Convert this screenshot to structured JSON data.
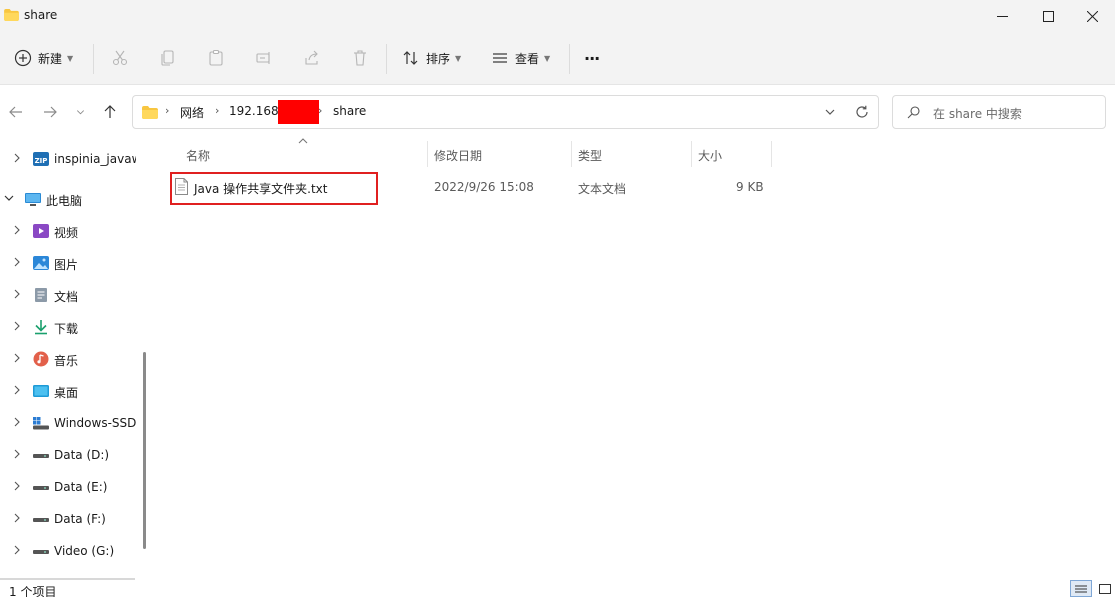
{
  "window": {
    "title": "share"
  },
  "toolbar": {
    "new_label": "新建",
    "sort_label": "排序",
    "view_label": "查看",
    "more_label": "···"
  },
  "address": {
    "crumbs": [
      "网络",
      "192.168.",
      "share"
    ]
  },
  "search": {
    "placeholder": "在 share 中搜索"
  },
  "sidebar": {
    "items": [
      {
        "label": "inspinia_javaw",
        "icon": "zip-folder-icon"
      },
      {
        "label": "此电脑",
        "icon": "computer-icon"
      },
      {
        "label": "视频",
        "icon": "videos-icon"
      },
      {
        "label": "图片",
        "icon": "pictures-icon"
      },
      {
        "label": "文档",
        "icon": "documents-icon"
      },
      {
        "label": "下载",
        "icon": "downloads-icon"
      },
      {
        "label": "音乐",
        "icon": "music-icon"
      },
      {
        "label": "桌面",
        "icon": "desktop-icon"
      },
      {
        "label": "Windows-SSD",
        "icon": "windows-drive-icon"
      },
      {
        "label": "Data (D:)",
        "icon": "drive-icon"
      },
      {
        "label": "Data (E:)",
        "icon": "drive-icon"
      },
      {
        "label": "Data (F:)",
        "icon": "drive-icon"
      },
      {
        "label": "Video (G:)",
        "icon": "drive-icon"
      }
    ]
  },
  "files": {
    "columns": [
      "名称",
      "修改日期",
      "类型",
      "大小"
    ],
    "rows": [
      {
        "name": "Java 操作共享文件夹.txt",
        "modified": "2022/9/26 15:08",
        "type": "文本文档",
        "size": "9 KB"
      }
    ]
  },
  "status": {
    "count": "1 个项目"
  },
  "colors": {
    "accent": "#0067c0",
    "highlight_border": "#e02020",
    "redaction": "#ff0000"
  }
}
